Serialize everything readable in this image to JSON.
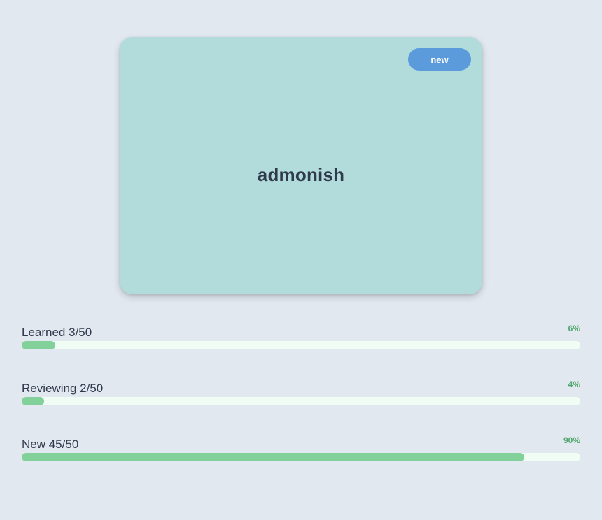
{
  "card": {
    "badge_label": "new",
    "word": "admonish"
  },
  "stats": [
    {
      "label": "Learned 3/50",
      "percent_label": "6%",
      "fraction": 0.06
    },
    {
      "label": "Reviewing 2/50",
      "percent_label": "4%",
      "fraction": 0.04
    },
    {
      "label": "New 45/50",
      "percent_label": "90%",
      "fraction": 0.9
    }
  ],
  "colors": {
    "background": "#e2e8f0",
    "card": "#b2dbdc",
    "badge": "#5b9bdc",
    "track": "#f0fdf4",
    "fill": "#82d09a",
    "percent_text": "#4fa56b",
    "text": "#2f3b4c"
  }
}
